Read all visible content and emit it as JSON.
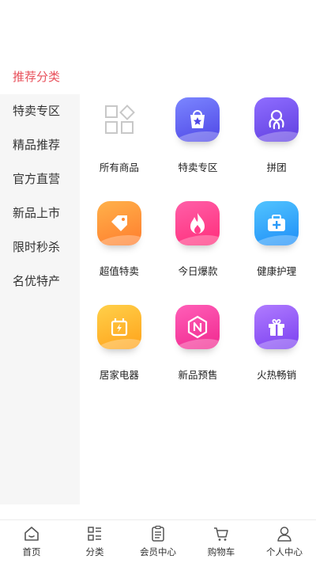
{
  "sidebar": {
    "items": [
      {
        "label": "推荐分类",
        "active": true
      },
      {
        "label": "特卖专区",
        "active": false
      },
      {
        "label": "精品推荐",
        "active": false
      },
      {
        "label": "官方直营",
        "active": false
      },
      {
        "label": "新品上市",
        "active": false
      },
      {
        "label": "限时秒杀",
        "active": false
      },
      {
        "label": "名优特产",
        "active": false
      }
    ]
  },
  "grid": {
    "items": [
      {
        "label": "所有商品",
        "icon": "all-products-icon"
      },
      {
        "label": "特卖专区",
        "icon": "shopping-bag-star-icon"
      },
      {
        "label": "拼团",
        "icon": "group-buy-icon"
      },
      {
        "label": "超值特卖",
        "icon": "price-tag-icon"
      },
      {
        "label": "今日爆款",
        "icon": "flame-icon"
      },
      {
        "label": "健康护理",
        "icon": "medical-kit-icon"
      },
      {
        "label": "居家电器",
        "icon": "appliance-icon"
      },
      {
        "label": "新品预售",
        "icon": "new-badge-icon"
      },
      {
        "label": "火热畅销",
        "icon": "gift-icon"
      }
    ]
  },
  "tabbar": {
    "items": [
      {
        "label": "首页",
        "icon": "home-icon"
      },
      {
        "label": "分类",
        "icon": "category-icon"
      },
      {
        "label": "会员中心",
        "icon": "member-icon"
      },
      {
        "label": "购物车",
        "icon": "cart-icon"
      },
      {
        "label": "个人中心",
        "icon": "profile-icon"
      }
    ]
  },
  "colors": {
    "active": "#e8505b",
    "sidebar_bg": "#f6f6f6"
  }
}
